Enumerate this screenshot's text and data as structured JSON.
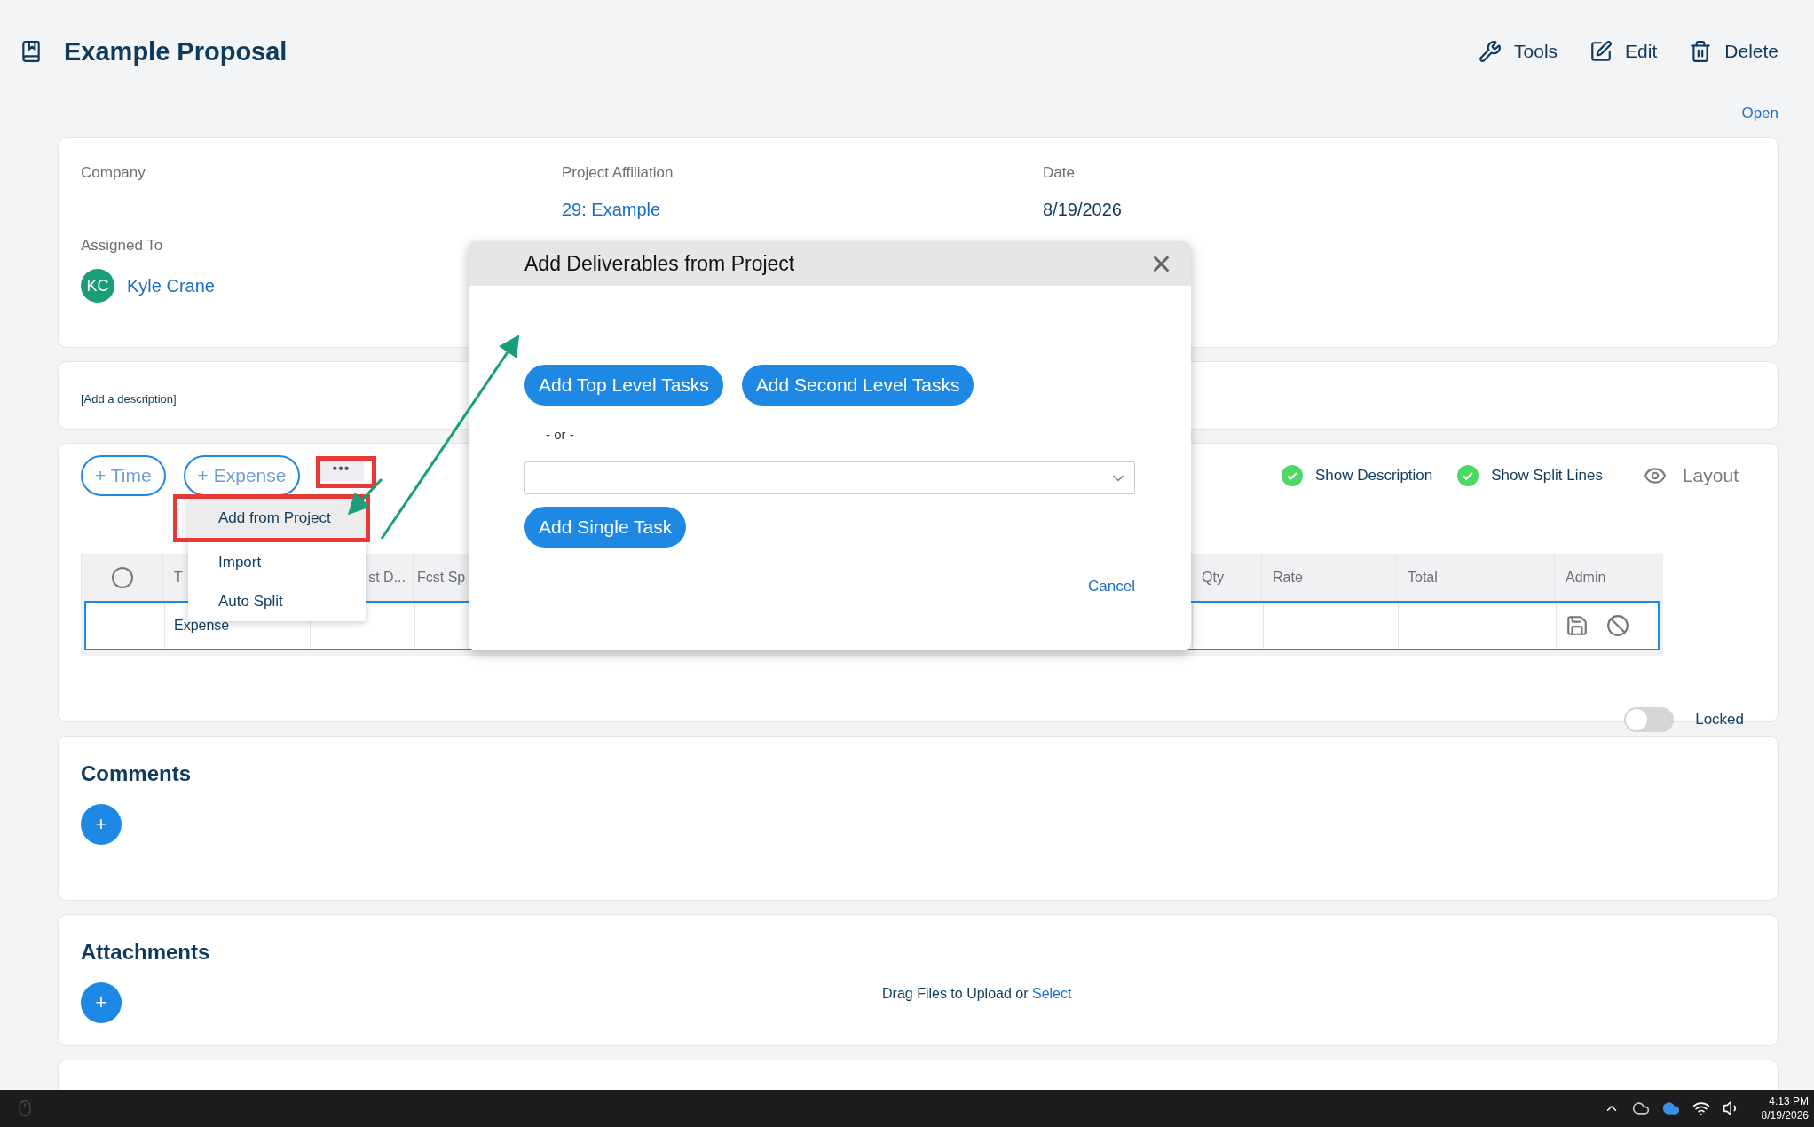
{
  "header": {
    "title": "Example Proposal",
    "actions": [
      {
        "kind": "tools",
        "label": "Tools"
      },
      {
        "kind": "edit",
        "label": "Edit"
      },
      {
        "kind": "delete",
        "label": "Delete"
      }
    ],
    "status": "Open"
  },
  "details": {
    "company_label": "Company",
    "project_label": "Project Affiliation",
    "project_value": "29: Example",
    "date_label": "Date",
    "date_value": "8/19/2026",
    "assigned_label": "Assigned To",
    "assignee_initials": "KC",
    "assignee_name": "Kyle Crane"
  },
  "description": {
    "placeholder": "[Add a description]"
  },
  "lines": {
    "add_buttons": [
      "+ Time",
      "+ Expense"
    ],
    "more_button": "•••",
    "more_menu": [
      {
        "label": "Add from Project",
        "selected": true
      },
      {
        "label": "Import",
        "selected": false
      },
      {
        "label": "Auto Split",
        "selected": false
      }
    ],
    "toggles": [
      {
        "label": "Show Description",
        "checked": true
      },
      {
        "label": "Show Split Lines",
        "checked": true
      }
    ],
    "layout_button": "Layout",
    "table": {
      "select_all": {
        "checked": false
      },
      "columns": [
        "T",
        "st D...",
        "Fcst Sp",
        "Qty",
        "Rate",
        "Total",
        "Admin"
      ],
      "rows": [
        {
          "type": "Expense",
          "editing": true
        }
      ]
    },
    "locked": {
      "label": "Locked",
      "on": false
    }
  },
  "comments": {
    "title": "Comments",
    "add_button": "+"
  },
  "attachments": {
    "title": "Attachments",
    "add_button": "+",
    "drop_hint": "Drag Files to Upload or",
    "select_link": "Select"
  },
  "dialog": {
    "title": "Add Deliverables from Project",
    "close": "×",
    "buttons": [
      "Add Top Level Tasks",
      "Add Second Level Tasks"
    ],
    "separator": "- or -",
    "single_task_button": "Add Single Task",
    "cancel": "Cancel"
  },
  "taskbar": {
    "time": "4:13 PM",
    "date": "8/19/2026"
  }
}
